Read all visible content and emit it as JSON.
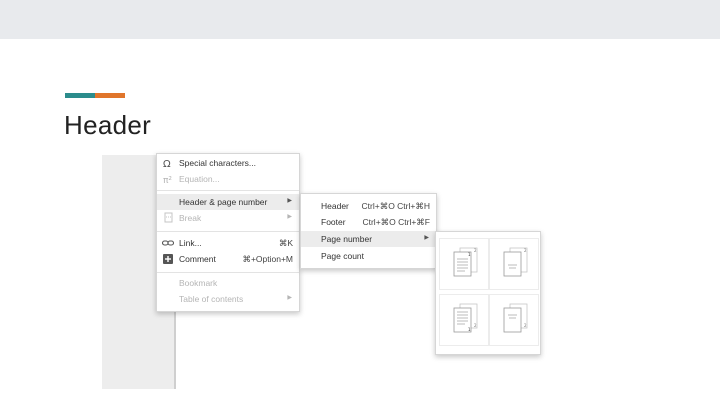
{
  "slide": {
    "title": "Header",
    "colors": {
      "accent_teal": "#2b8c8c",
      "accent_orange": "#e0752b"
    }
  },
  "insert_menu": {
    "items": [
      {
        "label": "Special characters...",
        "icon": "omega-icon",
        "shortcut": "",
        "has_submenu": false,
        "disabled": false
      },
      {
        "label": "Equation...",
        "icon": "pi-icon",
        "shortcut": "",
        "has_submenu": false,
        "disabled": true
      },
      {
        "label": "Header & page number",
        "icon": "",
        "shortcut": "",
        "has_submenu": true,
        "disabled": false,
        "highlighted": true
      },
      {
        "label": "Break",
        "icon": "page-break-icon",
        "shortcut": "",
        "has_submenu": true,
        "disabled": true
      },
      {
        "label": "Link...",
        "icon": "link-icon",
        "shortcut": "⌘K",
        "has_submenu": false,
        "disabled": false
      },
      {
        "label": "Comment",
        "icon": "comment-add-icon",
        "shortcut": "⌘+Option+M",
        "has_submenu": false,
        "disabled": false
      },
      {
        "label": "Bookmark",
        "icon": "",
        "shortcut": "",
        "has_submenu": false,
        "disabled": true
      },
      {
        "label": "Table of contents",
        "icon": "",
        "shortcut": "",
        "has_submenu": true,
        "disabled": true
      }
    ]
  },
  "header_submenu": {
    "items": [
      {
        "label": "Header",
        "shortcut": "Ctrl+⌘O Ctrl+⌘H"
      },
      {
        "label": "Footer",
        "shortcut": "Ctrl+⌘O Ctrl+⌘F"
      },
      {
        "label": "Page number",
        "shortcut": "",
        "has_submenu": true,
        "highlighted": true
      },
      {
        "label": "Page count",
        "shortcut": ""
      }
    ]
  },
  "page_number_options": [
    {
      "name": "page-number-top-right-all-pages",
      "icon": "page-thumbnail-icon"
    },
    {
      "name": "page-number-top-right-skip-first",
      "icon": "page-thumbnail-icon"
    },
    {
      "name": "page-number-bottom-right-all-pages",
      "icon": "page-thumbnail-icon"
    },
    {
      "name": "page-number-bottom-right-skip-first",
      "icon": "page-thumbnail-icon"
    }
  ]
}
